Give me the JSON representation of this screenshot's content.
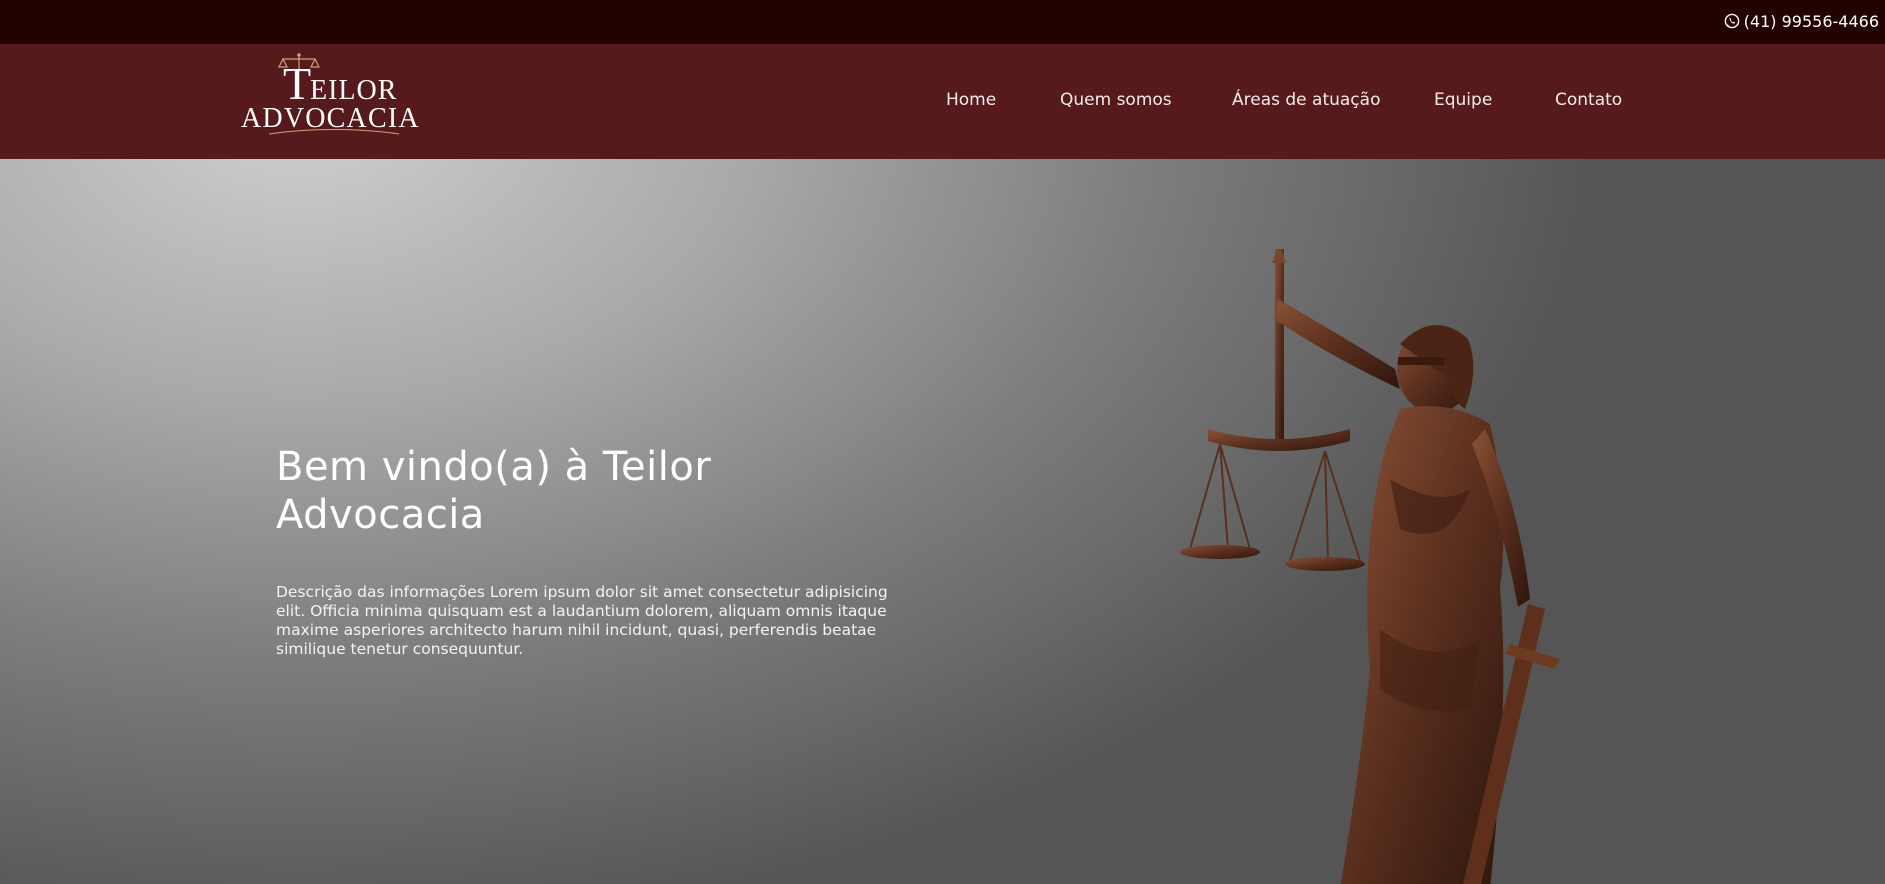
{
  "topbar": {
    "phone_icon": "whatsapp-icon",
    "phone": "(41) 99556-4466"
  },
  "logo": {
    "line1": "TEILOR",
    "line2": "ADVOCACIA",
    "icon": "scales-icon"
  },
  "nav": {
    "items": [
      {
        "label": "Home"
      },
      {
        "label": "Quem somos"
      },
      {
        "label": "Áreas de atuação"
      },
      {
        "label": "Equipe"
      },
      {
        "label": "Contato"
      }
    ]
  },
  "hero": {
    "title": "Bem vindo(a) à Teilor Advocacia",
    "description": "Descrição das informações Lorem ipsum dolor sit amet consectetur adipisicing elit. Officia minima quisquam est a laudantium dolorem, aliquam omnis itaque maxime asperiores architecto harum nihil incidunt, quasi, perferendis beatae similique tenetur consequuntur.",
    "image": "lady-justice-statue"
  },
  "colors": {
    "topbar": "#230202",
    "navbar": "#561a1d",
    "bronze": "#5a2f1e"
  }
}
